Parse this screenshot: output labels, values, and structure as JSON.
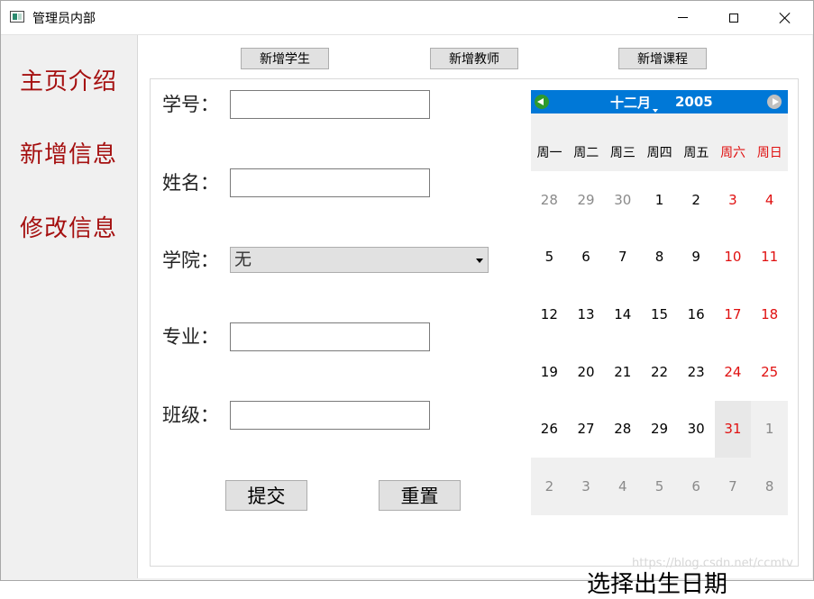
{
  "window": {
    "title": "管理员内部",
    "controls": {
      "minimize": "minimize-icon",
      "maximize": "maximize-icon",
      "close": "close-icon"
    }
  },
  "sidebar": {
    "items": [
      {
        "label": "主页介绍"
      },
      {
        "label": "新增信息"
      },
      {
        "label": "修改信息"
      }
    ]
  },
  "toolbar": {
    "buttons": [
      {
        "label": "新增学生"
      },
      {
        "label": "新增教师"
      },
      {
        "label": "新增课程"
      }
    ]
  },
  "form": {
    "student_id_label": "学号：",
    "student_id_value": "",
    "name_label": "姓名：",
    "name_value": "",
    "college_label": "学院：",
    "college_selected": "无",
    "major_label": "专业：",
    "major_value": "",
    "class_label": "班级：",
    "class_value": "",
    "submit_label": "提交",
    "reset_label": "重置"
  },
  "calendar": {
    "month": "十二月",
    "year": "2005",
    "weekdays": [
      "周一",
      "周二",
      "周三",
      "周四",
      "周五",
      "周六",
      "周日"
    ],
    "weeks": [
      [
        "28",
        "29",
        "30",
        "1",
        "2",
        "3",
        "4"
      ],
      [
        "5",
        "6",
        "7",
        "8",
        "9",
        "10",
        "11"
      ],
      [
        "12",
        "13",
        "14",
        "15",
        "16",
        "17",
        "18"
      ],
      [
        "19",
        "20",
        "21",
        "22",
        "23",
        "24",
        "25"
      ],
      [
        "26",
        "27",
        "28",
        "29",
        "30",
        "31",
        "1"
      ],
      [
        "2",
        "3",
        "4",
        "5",
        "6",
        "7",
        "8"
      ]
    ],
    "selected_day": "31",
    "caption": "选择出生日期",
    "colors": {
      "header": "#0078d7",
      "weekend": "#e01010",
      "other_month": "#8a8a8a"
    }
  },
  "watermark": "https://blog.csdn.net/ccmtv",
  "colors": {
    "sidebar_text": "#a51010"
  }
}
